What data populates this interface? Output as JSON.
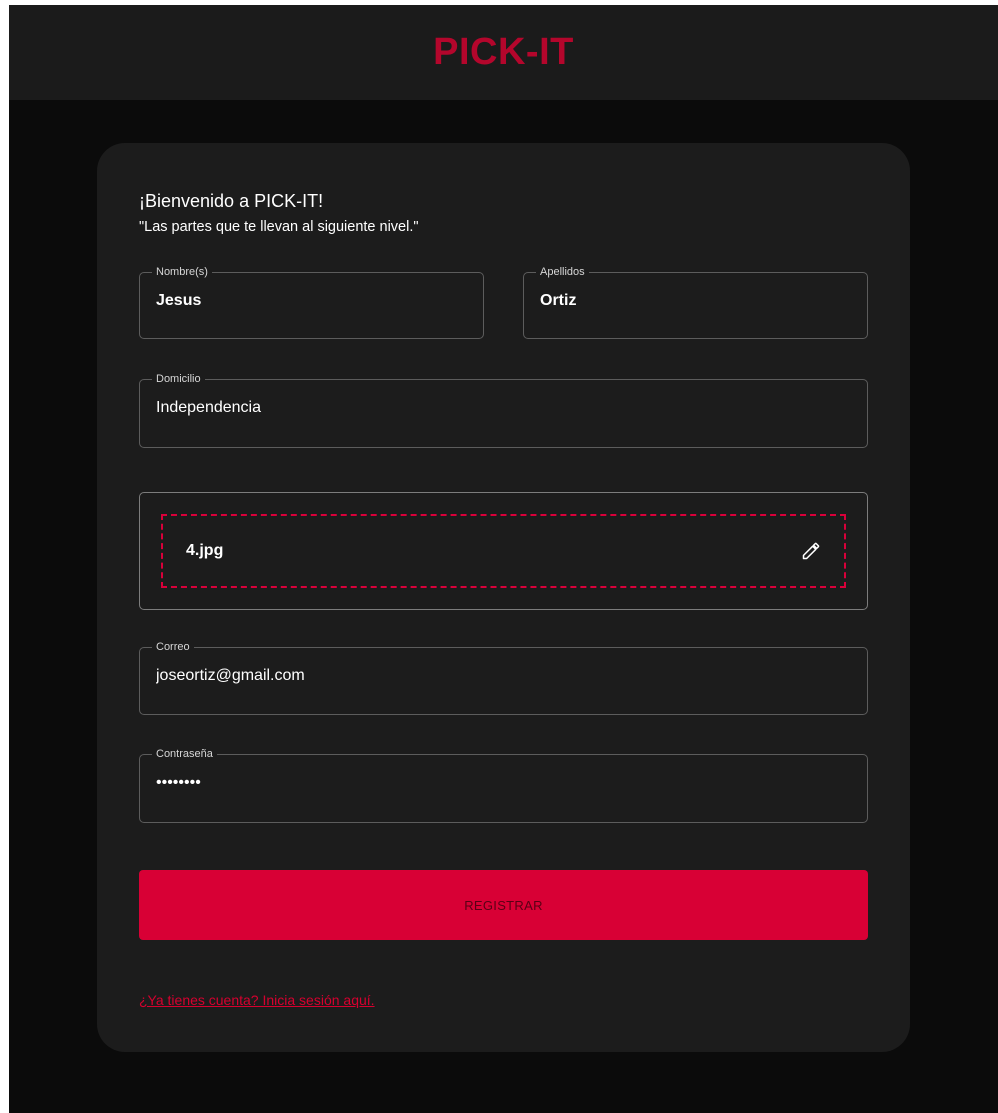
{
  "header": {
    "brand": "PICK-IT"
  },
  "form": {
    "welcome": "¡Bienvenido a PICK-IT!",
    "subtitle": "\"Las partes que te llevan al siguiente nivel.\"",
    "fields": {
      "nombre": {
        "label": "Nombre(s)",
        "value": "Jesus"
      },
      "apellidos": {
        "label": "Apellidos",
        "value": "Ortiz"
      },
      "domicilio": {
        "label": "Domicilio",
        "value": "Independencia"
      },
      "correo": {
        "label": "Correo",
        "value": "joseortiz@gmail.com"
      },
      "contrasena": {
        "label": "Contraseña",
        "value": "password"
      }
    },
    "file": {
      "name": "4.jpg",
      "icon": "pencil-icon"
    },
    "register_label": "REGISTRAR",
    "login_link": "¿Ya tienes cuenta? Inicia sesión aquí."
  },
  "colors": {
    "accent": "#d80035",
    "brand": "#b4062c",
    "card": "#1c1c1c",
    "background": "#0b0b0b",
    "header": "#1b1b1b"
  }
}
